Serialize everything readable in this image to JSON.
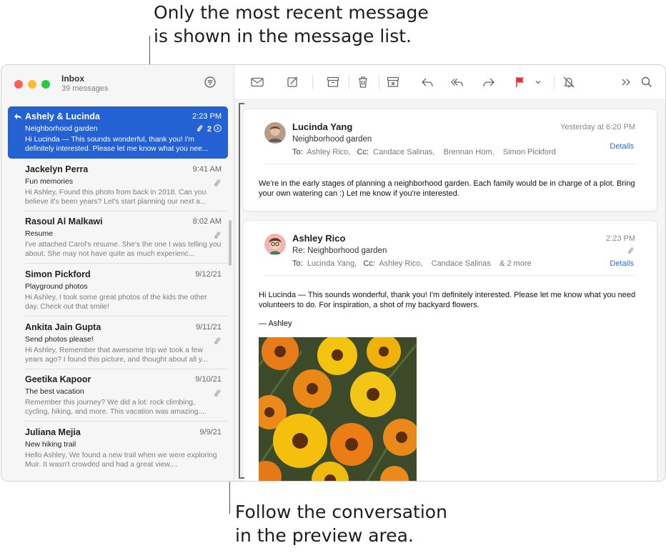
{
  "callouts": {
    "top_line1": "Only the most recent message",
    "top_line2": "is shown in the message list.",
    "bottom_line1": "Follow the conversation",
    "bottom_line2": "in the preview area."
  },
  "mailbox": {
    "title": "Inbox",
    "count": "39 messages",
    "filter_icon": "filter-circle-icon"
  },
  "messages": [
    {
      "sender": "Ashely & Lucinda",
      "date": "2:23 PM",
      "subject": "Neighborhood garden",
      "preview": "Hi Lucinda — This sounds wonderful, thank you! I'm definitely interested. Please let me know what you nee...",
      "thread_count": "2"
    },
    {
      "sender": "Jackelyn Perra",
      "date": "9:41 AM",
      "subject": "Fun memories",
      "preview": "Hi Ashley, Found this photo from back in 2018. Can you believe it's been years? Let's start planning our next a..."
    },
    {
      "sender": "Rasoul Al Malkawi",
      "date": "8:02 AM",
      "subject": "Resume",
      "preview": "I've attached Carol's resume. She's the one I was telling you about. She may not have quite as much experienc..."
    },
    {
      "sender": "Simon Pickford",
      "date": "9/12/21",
      "subject": "Playground photos",
      "preview": "Hi Ashley, I took some great photos of the kids the other day. Check out that smile!"
    },
    {
      "sender": "Ankita Jain Gupta",
      "date": "9/11/21",
      "subject": "Send photos please!",
      "preview": "Hi Ashley, Remember that awesome trip we took a few years ago? I found this picture, and thought about all y..."
    },
    {
      "sender": "Geetika Kapoor",
      "date": "9/10/21",
      "subject": "The best vacation",
      "preview": "Remember this journey? We did a lot: rock climbing, cycling, hiking, and more. This vacation was amazing...."
    },
    {
      "sender": "Juliana Mejia",
      "date": "9/9/21",
      "subject": "New hiking trail",
      "preview": "Hello Ashley, We found a new trail when we were exploring Muir. It wasn't crowded and had a great view...."
    }
  ],
  "toolbar": [
    "envelope-icon",
    "compose-icon",
    "archive-icon",
    "trash-icon",
    "junk-icon",
    "reply-icon",
    "reply-all-icon",
    "forward-icon",
    "flag-icon",
    "chevron-down-icon",
    "mute-bell-icon",
    "more-chevrons-icon",
    "search-icon"
  ],
  "colors": {
    "selection": "#2462d4",
    "flag": "#e0332b",
    "link": "#2a6ed8"
  },
  "conversation": [
    {
      "from": "Lucinda Yang",
      "date": "Yesterday at 6:20 PM",
      "subject": "Neighborhood garden",
      "to_label": "To:",
      "to": "Ashley Rico,",
      "cc_label": "Cc:",
      "cc1": "Candace Salinas,",
      "cc2": "Brennan Hom,",
      "cc3": "Simon Pickford",
      "details": "Details",
      "body": "We're in the early stages of planning a neighborhood garden. Each family would be in charge of a plot. Bring your own watering can :) Let me know if you're interested."
    },
    {
      "from": "Ashley Rico",
      "date": "2:23 PM",
      "subject": "Re: Neighborhood garden",
      "to_label": "To:",
      "to": "Lucinda Yang,",
      "cc_label": "Cc:",
      "cc1": "Ashley Rico,",
      "cc2": "Candace Salinas",
      "more": "& 2 more",
      "details": "Details",
      "body1": "Hi Lucinda — This sounds wonderful, thank you! I'm definitely interested. Please let me know what you need volunteers to do. For inspiration, a shot of my backyard flowers.",
      "signature": "— Ashley"
    }
  ]
}
